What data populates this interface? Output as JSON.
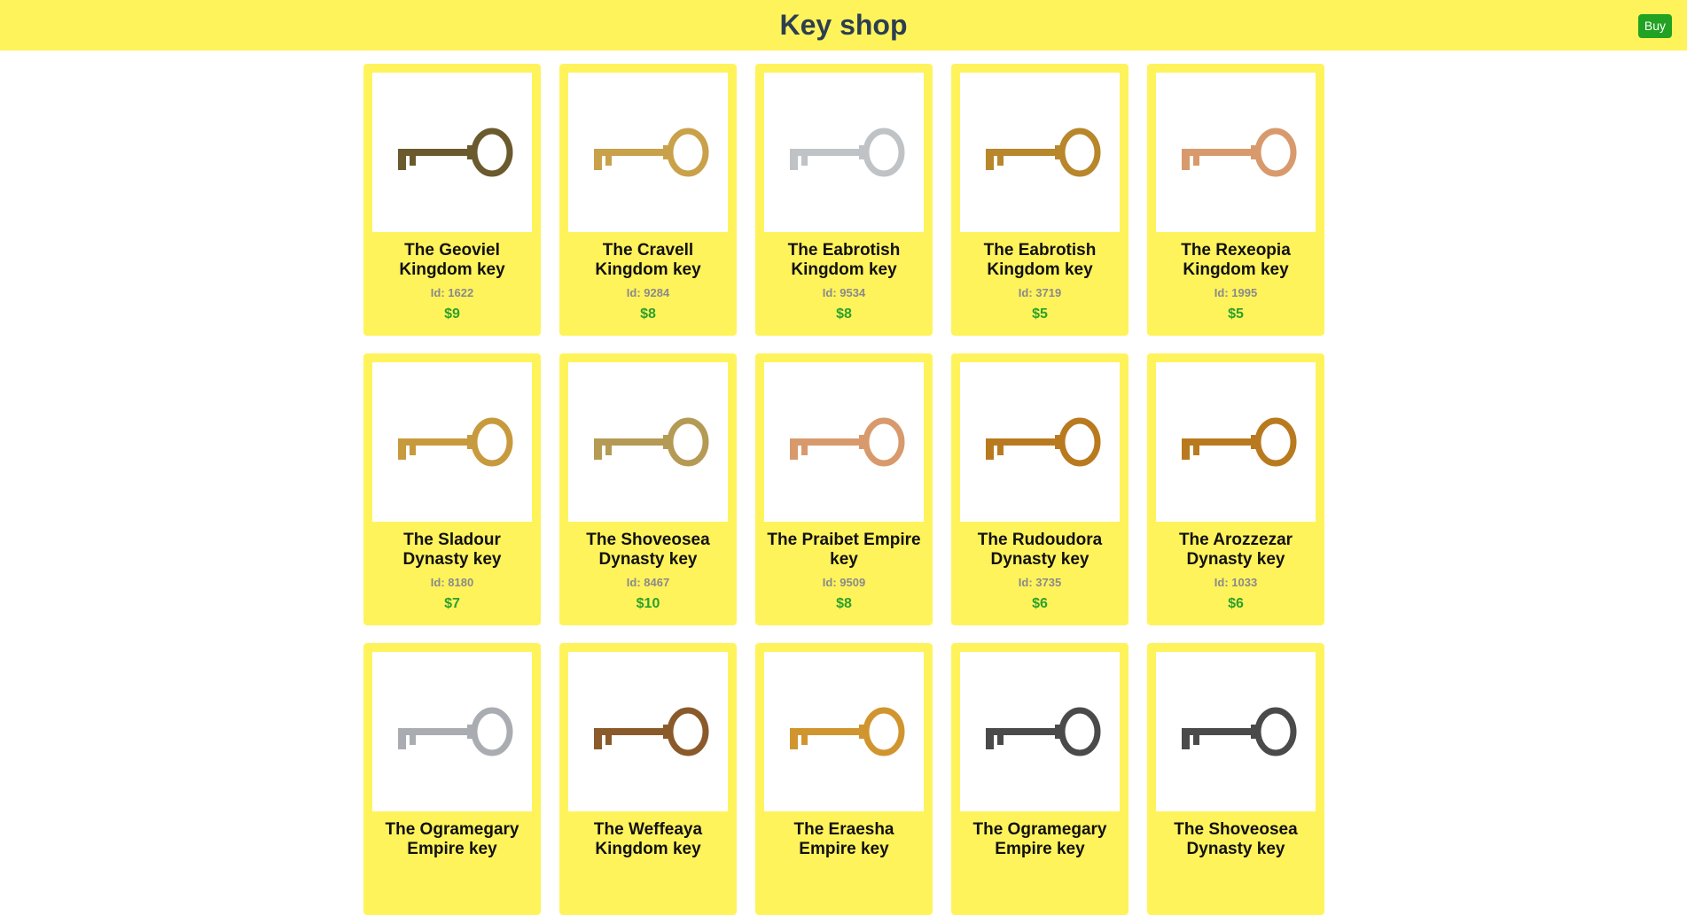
{
  "header": {
    "title": "Key shop",
    "buy_label": "Buy"
  },
  "products": [
    {
      "name": "The Geoviel Kingdom key",
      "id_label": "Id: 1622",
      "price": "$9",
      "icon": "antique-bronze-key-icon",
      "color": "#6b5a2e"
    },
    {
      "name": "The Cravell Kingdom key",
      "id_label": "Id: 9284",
      "price": "$8",
      "icon": "gold-skeleton-key-icon",
      "color": "#c9a14a"
    },
    {
      "name": "The Eabrotish Kingdom key",
      "id_label": "Id: 9534",
      "price": "$8",
      "icon": "silver-key-icon",
      "color": "#bfc3c6"
    },
    {
      "name": "The Eabrotish Kingdom key",
      "id_label": "Id: 3719",
      "price": "$5",
      "icon": "ornate-gold-key-icon",
      "color": "#b8862b"
    },
    {
      "name": "The Rexeopia Kingdom key",
      "id_label": "Id: 1995",
      "price": "$5",
      "icon": "copper-house-key-icon",
      "color": "#d89a6c"
    },
    {
      "name": "The Sladour Dynasty key",
      "id_label": "Id: 8180",
      "price": "$7",
      "icon": "ornate-gold-key-icon",
      "color": "#c89a3e"
    },
    {
      "name": "The Shoveosea Dynasty key",
      "id_label": "Id: 8467",
      "price": "$10",
      "icon": "gold-success-key-icon",
      "color": "#b59a55"
    },
    {
      "name": "The Praibet Empire key",
      "id_label": "Id: 9509",
      "price": "$8",
      "icon": "copper-house-key-icon",
      "color": "#d89a6c"
    },
    {
      "name": "The Rudoudora Dynasty key",
      "id_label": "Id: 3735",
      "price": "$6",
      "icon": "ornate-gold-key-icon",
      "color": "#b97a1f"
    },
    {
      "name": "The Arozzezar Dynasty key",
      "id_label": "Id: 1033",
      "price": "$6",
      "icon": "ornate-gold-key-icon",
      "color": "#b97a1f"
    },
    {
      "name": "The Ogramegary Empire key",
      "id_label": "",
      "price": "",
      "icon": "silver-key-icon",
      "color": "#a9adb2"
    },
    {
      "name": "The Weffeaya Kingdom key",
      "id_label": "",
      "price": "",
      "icon": "bronze-key-icon",
      "color": "#8a5a2b"
    },
    {
      "name": "The Eraesha Empire key",
      "id_label": "",
      "price": "",
      "icon": "gold-skeleton-key-icon",
      "color": "#d1952f"
    },
    {
      "name": "The Ogramegary Empire key",
      "id_label": "",
      "price": "",
      "icon": "iron-skeleton-key-icon",
      "color": "#4a4a4a"
    },
    {
      "name": "The Shoveosea Dynasty key",
      "id_label": "",
      "price": "",
      "icon": "iron-skeleton-key-icon",
      "color": "#4a4a4a"
    }
  ]
}
